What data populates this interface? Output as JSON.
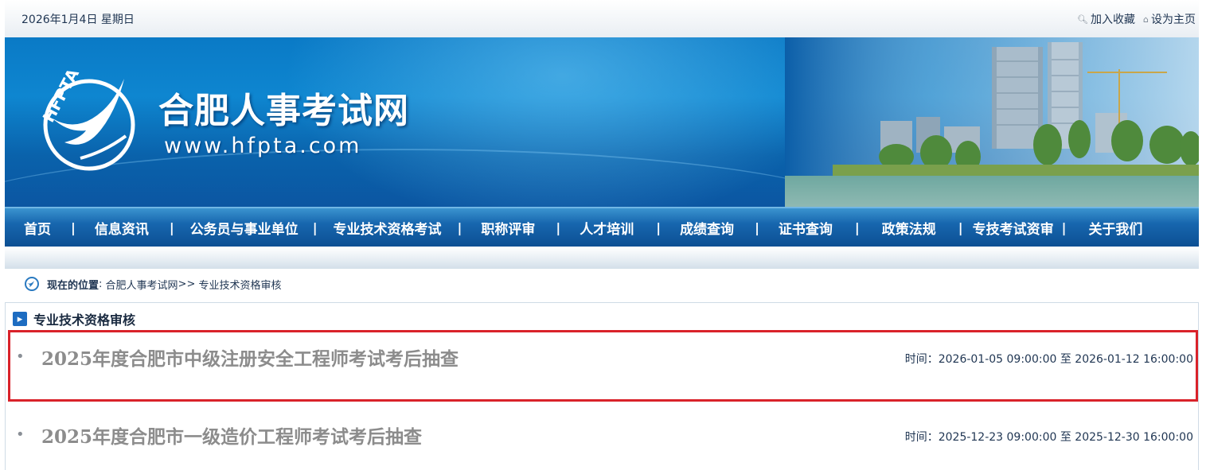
{
  "topbar": {
    "date": "2026年1月4日 星期日",
    "favorite": "加入收藏",
    "homepage": "设为主页",
    "favorite_icon": "search-key-icon",
    "homepage_icon": "home-icon"
  },
  "banner": {
    "logo_text": "HFPTA",
    "site_name": "合肥人事考试网",
    "site_url": "www.hfpta.com"
  },
  "nav": {
    "items": [
      "首页",
      "信息资讯",
      "公务员与事业单位",
      "专业技术资格考试",
      "职称评审",
      "人才培训",
      "成绩查询",
      "证书查询",
      "政策法规",
      "专技考试资审",
      "关于我们"
    ]
  },
  "breadcrumb": {
    "label": "现在的位置",
    "path_root": "合肥人事考试网",
    "path_sep": ">>",
    "path_current": "专业技术资格审核"
  },
  "section": {
    "title": "专业技术资格审核"
  },
  "list": [
    {
      "title": "2025年度合肥市中级注册安全工程师考试考后抽查",
      "time": "时间：2026-01-05 09:00:00 至 2026-01-12 16:00:00",
      "highlighted": true
    },
    {
      "title": "2025年度合肥市一级造价工程师考试考后抽查",
      "time": "时间：2025-12-23 09:00:00 至 2025-12-30 16:00:00",
      "highlighted": false
    }
  ],
  "colors": {
    "highlight_border": "#d9222a",
    "nav_bg": "#1766ae",
    "banner_bg": "#0a7ac6"
  }
}
